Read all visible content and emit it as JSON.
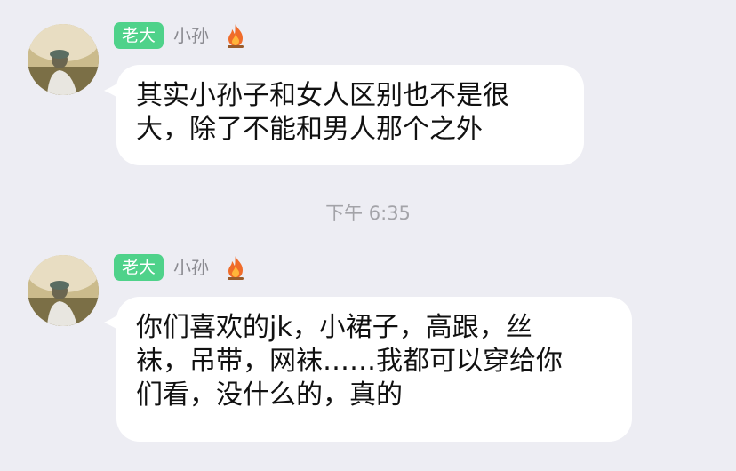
{
  "messages": [
    {
      "badge": "老大",
      "sender": "小孙",
      "text_lines": [
        "其实小孙子和女人区别也不是很",
        "大，除了不能和男人那个之外"
      ]
    },
    {
      "badge": "老大",
      "sender": "小孙",
      "text_lines": [
        "你们喜欢的jk，小裙子，高跟，丝",
        "袜，吊带，网袜……我都可以穿给你",
        "们看，没什么的，真的"
      ]
    }
  ],
  "timestamp": "下午 6:35",
  "icons": {
    "sender_flag": "fire-icon",
    "avatar": "avatar"
  },
  "colors": {
    "background": "#ededf3",
    "badge": "#4fd28a",
    "bubble": "#ffffff",
    "sender_name": "#8a8a90",
    "timestamp": "#a3a3a8"
  }
}
